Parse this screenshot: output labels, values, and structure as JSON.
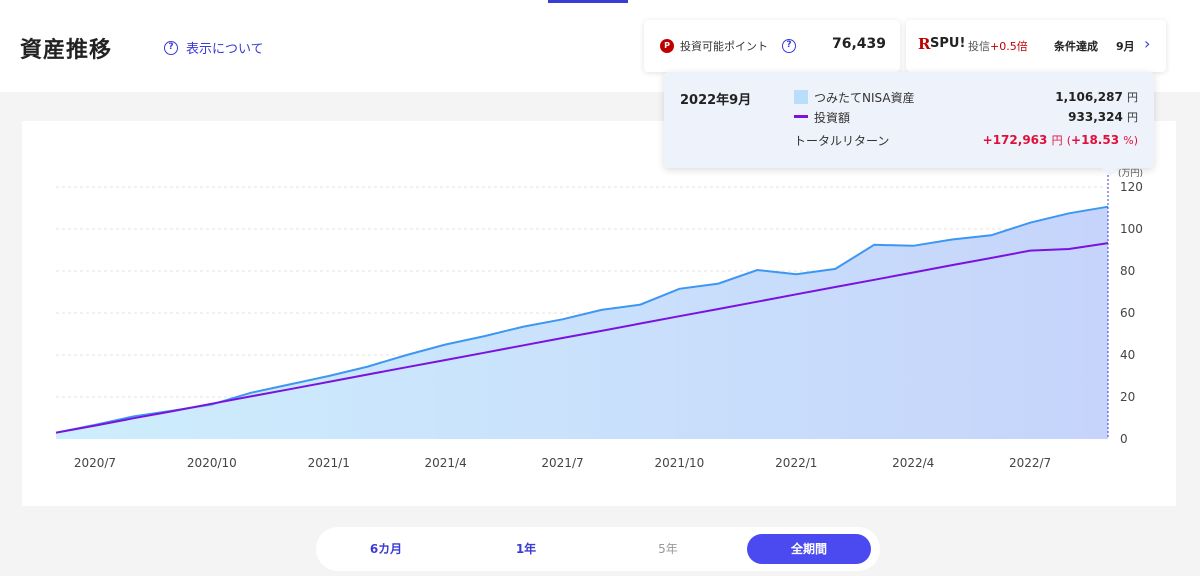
{
  "header": {
    "title": "資産推移",
    "help_link": "表示について",
    "points": {
      "label": "投資可能ポイント",
      "value": "76,439"
    },
    "spu": {
      "r": "R",
      "logo": "SPU!",
      "investment": "投信",
      "bonus": "+0.5倍",
      "condition": "条件達成",
      "month": "9月"
    }
  },
  "tooltip": {
    "date": "2022年9月",
    "asset_label": "つみたてNISA資産",
    "asset_value": "1,106,287",
    "invest_label": "投資額",
    "invest_value": "933,324",
    "unit": "円",
    "return_label": "トータルリターン",
    "return_amount": "+172,963",
    "return_pct": "+18.53",
    "pct_unit": "%",
    "open_paren": "(",
    "close_paren": ")"
  },
  "colors": {
    "area_stroke": "#3d97f2",
    "invest_line": "#7a12e0",
    "accent": "#4a4af0",
    "negative_red": "#e0103c"
  },
  "chart_data": {
    "type": "area",
    "unit_label": "(万円)",
    "ylim": [
      0,
      120
    ],
    "y_ticks": [
      0,
      20,
      40,
      60,
      80,
      100,
      120
    ],
    "x_ticks": [
      "2020/7",
      "2020/10",
      "2021/1",
      "2021/4",
      "2021/7",
      "2021/10",
      "2022/1",
      "2022/4",
      "2022/7"
    ],
    "x_start": "2020/6",
    "series": [
      {
        "name": "つみたてNISA資産",
        "type": "area",
        "values": [
          3.0,
          6.7,
          10.8,
          13.5,
          16.5,
          22.0,
          26.0,
          30.0,
          34.5,
          40.0,
          45.0,
          49.0,
          53.5,
          57.0,
          61.5,
          64.0,
          71.5,
          74.0,
          80.5,
          78.5,
          81.0,
          92.5,
          92.0,
          95.0,
          97.0,
          103.0,
          107.5,
          110.6
        ]
      },
      {
        "name": "投資額",
        "type": "line",
        "values": [
          3.0,
          6.4,
          9.9,
          13.3,
          16.8,
          20.3,
          23.7,
          27.2,
          30.7,
          34.2,
          37.6,
          41.1,
          44.6,
          48.1,
          51.5,
          55.0,
          58.5,
          61.9,
          65.4,
          68.9,
          72.4,
          75.8,
          79.3,
          82.8,
          86.2,
          89.7,
          90.5,
          93.3
        ]
      }
    ]
  },
  "range_tabs": [
    {
      "label": "6カ月",
      "state": "link"
    },
    {
      "label": "1年",
      "state": "link"
    },
    {
      "label": "5年",
      "state": "disabled"
    },
    {
      "label": "全期間",
      "state": "active"
    }
  ]
}
